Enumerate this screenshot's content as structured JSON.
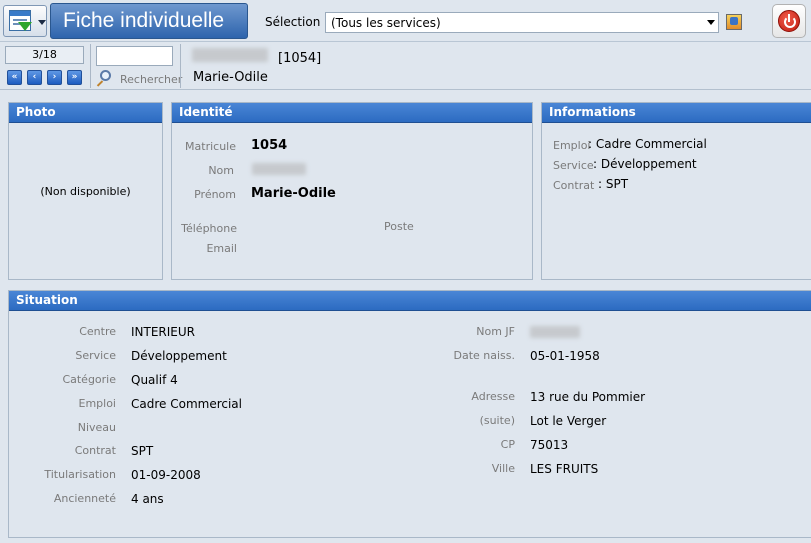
{
  "header": {
    "title": "Fiche individuelle",
    "selection_label": "Sélection",
    "selection_value": "(Tous les services)"
  },
  "nav": {
    "counter": "3/18",
    "first": "«",
    "prev": "‹",
    "next": "›",
    "last": "»",
    "search_value": "",
    "search_label": "Rechercher"
  },
  "record": {
    "id": "[1054]",
    "name": "Marie-Odile"
  },
  "photo": {
    "title": "Photo",
    "placeholder": "(Non disponible)"
  },
  "identite": {
    "title": "Identité",
    "matricule_label": "Matricule",
    "matricule": "1054",
    "nom_label": "Nom",
    "prenom_label": "Prénom",
    "prenom": "Marie-Odile",
    "telephone_label": "Téléphone",
    "poste_label": "Poste",
    "email_label": "Email"
  },
  "informations": {
    "title": "Informations",
    "emploi_label": "Emploi",
    "emploi": ": Cadre Commercial",
    "service_label": "Service",
    "service": ": Développement",
    "contrat_label": "Contrat",
    "contrat": ": SPT"
  },
  "situation": {
    "title": "Situation",
    "left": [
      {
        "label": "Centre",
        "value": "INTERIEUR"
      },
      {
        "label": "Service",
        "value": "Développement"
      },
      {
        "label": "Catégorie",
        "value": "Qualif 4"
      },
      {
        "label": "Emploi",
        "value": "Cadre Commercial"
      },
      {
        "label": "Niveau",
        "value": ""
      },
      {
        "label": "Contrat",
        "value": "SPT"
      },
      {
        "label": "Titularisation",
        "value": "01-09-2008"
      },
      {
        "label": "Ancienneté",
        "value": "4 ans"
      }
    ],
    "right": {
      "nomjf_label": "Nom JF",
      "date_label": "Date naiss.",
      "date": "05-01-1958",
      "adresse_label": "Adresse",
      "adresse": "13 rue du Pommier",
      "suite_label": "(suite)",
      "suite": "Lot le Verger",
      "cp_label": "CP",
      "cp": "75013",
      "ville_label": "Ville",
      "ville": "LES FRUITS"
    }
  }
}
